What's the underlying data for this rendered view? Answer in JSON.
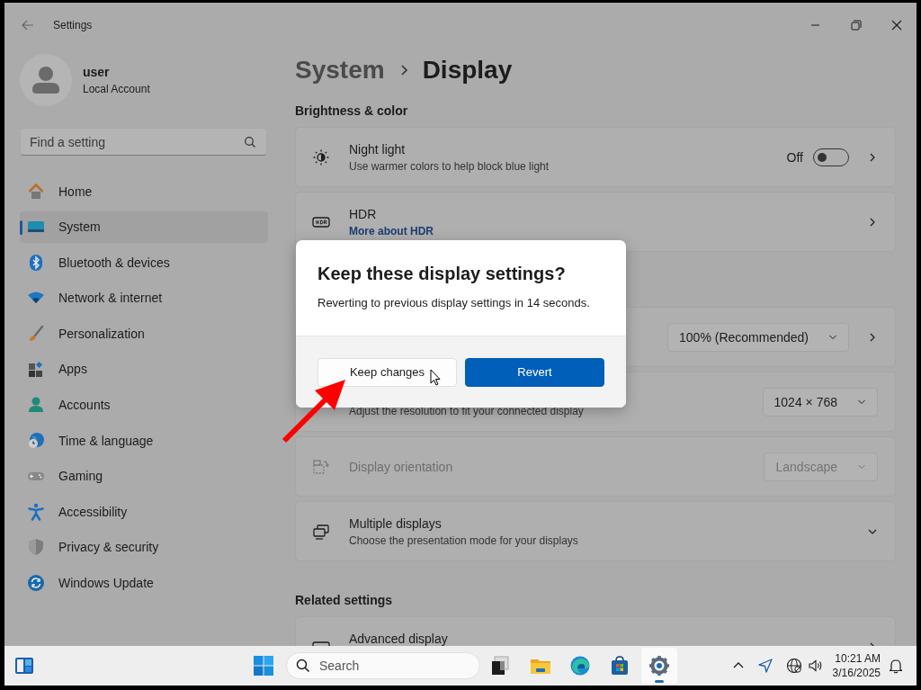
{
  "window": {
    "title": "Settings"
  },
  "account": {
    "name": "user",
    "type": "Local Account"
  },
  "search": {
    "placeholder": "Find a setting"
  },
  "sidebar": {
    "items": [
      {
        "label": "Home",
        "selected": false
      },
      {
        "label": "System",
        "selected": true
      },
      {
        "label": "Bluetooth & devices",
        "selected": false
      },
      {
        "label": "Network & internet",
        "selected": false
      },
      {
        "label": "Personalization",
        "selected": false
      },
      {
        "label": "Apps",
        "selected": false
      },
      {
        "label": "Accounts",
        "selected": false
      },
      {
        "label": "Time & language",
        "selected": false
      },
      {
        "label": "Gaming",
        "selected": false
      },
      {
        "label": "Accessibility",
        "selected": false
      },
      {
        "label": "Privacy & security",
        "selected": false
      },
      {
        "label": "Windows Update",
        "selected": false
      }
    ]
  },
  "breadcrumb": [
    "System",
    "Display"
  ],
  "sections": [
    {
      "heading": "Brightness & color",
      "cards": [
        {
          "kind": "toggle",
          "title": "Night light",
          "subtitle": "Use warmer colors to help block blue light",
          "value": "Off",
          "on": false
        },
        {
          "kind": "link",
          "title": "HDR",
          "link": "More about HDR"
        }
      ]
    },
    {
      "cards": [
        {
          "kind": "select-nav",
          "value": "100% (Recommended)",
          "disabled": false
        },
        {
          "kind": "select",
          "subtitle": "Adjust the resolution to fit your connected display",
          "value": "1024 × 768",
          "disabled": false
        },
        {
          "kind": "select",
          "title": "Display orientation",
          "value": "Landscape",
          "disabled": true
        },
        {
          "kind": "expander",
          "title": "Multiple displays",
          "subtitle": "Choose the presentation mode for your displays",
          "expanded": false
        }
      ]
    },
    {
      "heading": "Related settings",
      "cards": [
        {
          "kind": "nav",
          "title": "Advanced display"
        }
      ]
    }
  ],
  "dialog": {
    "title": "Keep these display settings?",
    "message": "Reverting to previous display settings in 14 seconds.",
    "buttons": [
      {
        "label": "Keep changes",
        "primary": false
      },
      {
        "label": "Revert",
        "primary": true
      }
    ]
  },
  "taskbar": {
    "search_placeholder": "Search",
    "apps": [
      {
        "selected": false
      },
      {
        "selected": false
      },
      {
        "selected": false
      },
      {
        "selected": false
      },
      {
        "selected": true
      }
    ],
    "time": "10:21 AM",
    "date": "3/16/2025"
  }
}
